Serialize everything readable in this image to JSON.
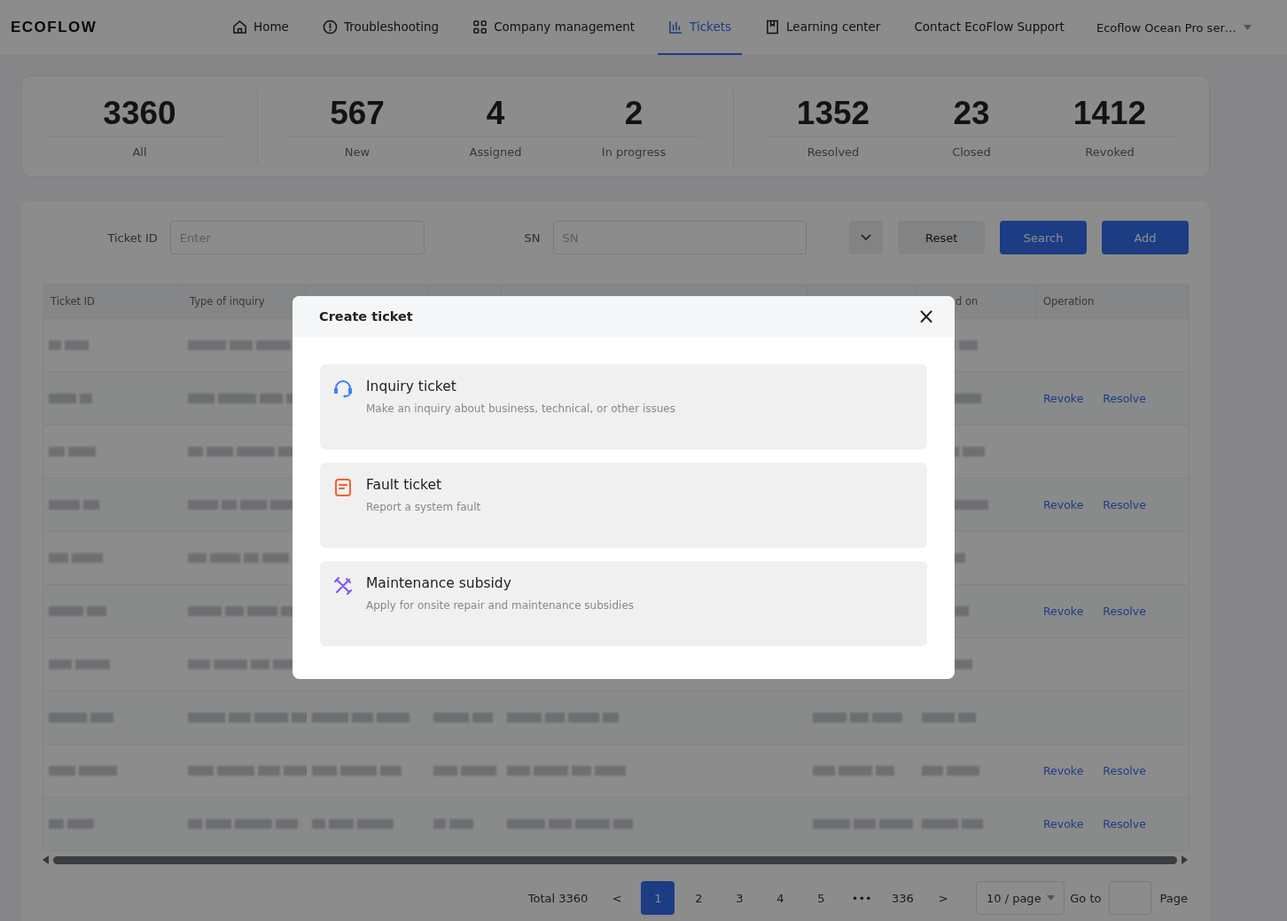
{
  "nav": {
    "logo": "ECOFLOW",
    "items": [
      {
        "label": "Home",
        "selected": false
      },
      {
        "label": "Troubleshooting",
        "selected": false
      },
      {
        "label": "Company management",
        "selected": false
      },
      {
        "label": "Tickets",
        "selected": true
      },
      {
        "label": "Learning center",
        "selected": false
      },
      {
        "label": "Contact EcoFlow Support",
        "selected": false
      }
    ],
    "account": "Ecoflow Ocean Pro ser…"
  },
  "stats": [
    [
      {
        "value": "3360",
        "label": "All"
      }
    ],
    [
      {
        "value": "567",
        "label": "New"
      },
      {
        "value": "4",
        "label": "Assigned"
      },
      {
        "value": "2",
        "label": "In progress"
      }
    ],
    [
      {
        "value": "1352",
        "label": "Resolved"
      },
      {
        "value": "23",
        "label": "Closed"
      },
      {
        "value": "1412",
        "label": "Revoked"
      }
    ]
  ],
  "filters": {
    "ticket_id": {
      "label": "Ticket ID",
      "placeholder": "Enter"
    },
    "sn": {
      "label": "SN",
      "placeholder": "SN"
    },
    "buttons": [
      {
        "label": "Reset",
        "kind": "default"
      },
      {
        "label": "Search",
        "kind": "primary"
      },
      {
        "label": "Add",
        "kind": "primary"
      }
    ]
  },
  "table": {
    "columns": [
      "Ticket ID",
      "Type of inquiry",
      "d on",
      "Operation"
    ],
    "rows": [
      {
        "blurred": true,
        "actions": []
      },
      {
        "blurred": true,
        "actions": [
          "Revoke",
          "Resolve"
        ]
      },
      {
        "blurred": true,
        "actions": []
      },
      {
        "blurred": true,
        "actions": [
          "Revoke",
          "Resolve"
        ]
      },
      {
        "blurred": true,
        "actions": []
      },
      {
        "blurred": true,
        "actions": [
          "Revoke",
          "Resolve"
        ]
      },
      {
        "blurred": true,
        "actions": []
      },
      {
        "blurred": true,
        "actions": []
      },
      {
        "blurred": true,
        "actions": [
          "Revoke",
          "Resolve"
        ]
      },
      {
        "blurred": true,
        "actions": [
          "Revoke",
          "Resolve"
        ]
      }
    ]
  },
  "pagination": {
    "total": "Total 3360",
    "prev": "<",
    "pages": [
      {
        "label": "1",
        "selected": true
      },
      {
        "label": "2",
        "selected": false
      },
      {
        "label": "3",
        "selected": false
      },
      {
        "label": "4",
        "selected": false
      },
      {
        "label": "5",
        "selected": false
      }
    ],
    "ellipsis": "•••",
    "last": "336",
    "next": ">",
    "page_size": "10 / page",
    "goto": "Go to",
    "page_word": "Page"
  },
  "modal": {
    "title": "Create ticket",
    "close": "×",
    "options": [
      {
        "kind": "inquiry",
        "title": "Inquiry ticket",
        "description": "Make an inquiry about business, technical, or other issues"
      },
      {
        "kind": "fault",
        "title": "Fault ticket",
        "description": "Report a system fault"
      },
      {
        "kind": "maintenance",
        "title": "Maintenance subsidy",
        "description": "Apply for onsite repair and maintenance subsidies"
      }
    ]
  }
}
